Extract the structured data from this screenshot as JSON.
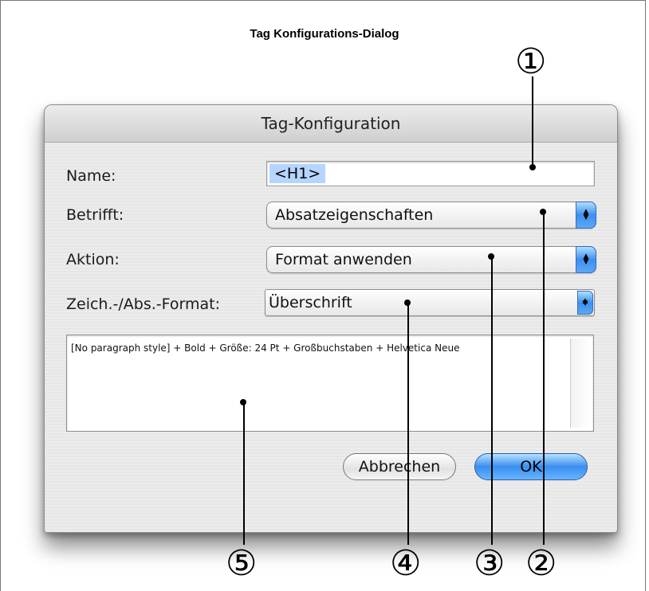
{
  "figure": {
    "title": "Tag Konfigurations-Dialog"
  },
  "dialog": {
    "title": "Tag-Konfiguration",
    "name": {
      "label": "Name:",
      "value": "<H1>"
    },
    "betrifft": {
      "label": "Betrifft:",
      "value": "Absatzeigenschaften"
    },
    "aktion": {
      "label": "Aktion:",
      "value": "Format anwenden"
    },
    "format": {
      "label": "Zeich.-/Abs.-Format:",
      "value": "Überschrift"
    },
    "description": "[No paragraph style] + Bold + Größe: 24 Pt + Großbuchstaben + Helvetica Neue",
    "cancel_label": "Abbrechen",
    "ok_label": "OK",
    "accent_color": "#3a8ef0"
  },
  "callouts": [
    "①",
    "②",
    "③",
    "④",
    "⑤"
  ],
  "icons": {
    "popup_arrows": "up-down-arrows-icon",
    "callout_marker": "dot-icon"
  }
}
